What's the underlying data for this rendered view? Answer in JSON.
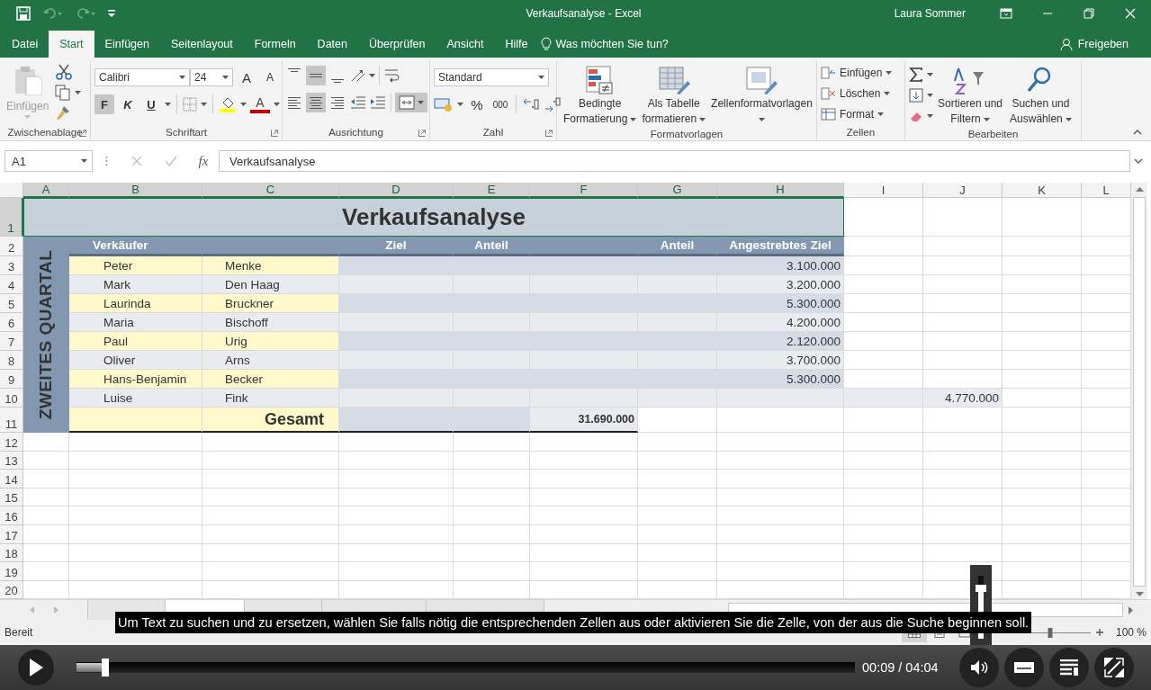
{
  "window": {
    "title": "Verkaufsanalyse - Excel",
    "user": "Laura Sommer"
  },
  "menu": {
    "tabs": [
      {
        "label": "Datei",
        "selected": false
      },
      {
        "label": "Start",
        "selected": true
      },
      {
        "label": "Einfügen",
        "selected": false
      },
      {
        "label": "Seitenlayout",
        "selected": false
      },
      {
        "label": "Formeln",
        "selected": false
      },
      {
        "label": "Daten",
        "selected": false
      },
      {
        "label": "Überprüfen",
        "selected": false
      },
      {
        "label": "Ansicht",
        "selected": false
      },
      {
        "label": "Hilfe",
        "selected": false
      }
    ],
    "tell_me": "Was möchten Sie tun?",
    "share": "Freigeben"
  },
  "ribbon": {
    "clipboard": {
      "label": "Zwischenablage",
      "paste": "Einfügen",
      "paste_disabled": true
    },
    "font": {
      "label": "Schriftart",
      "name": "Calibri",
      "size": "24",
      "grow": "A",
      "shrink": "A",
      "bold": "F",
      "italic": "K",
      "underline": "U",
      "font_color": "A",
      "bold_on": true
    },
    "alignment": {
      "label": "Ausrichtung",
      "vertical": [
        {
          "kind": "top",
          "selected": false
        },
        {
          "kind": "middle",
          "selected": true
        },
        {
          "kind": "bottom",
          "selected": false
        }
      ],
      "horizontal": [
        {
          "kind": "left",
          "selected": false
        },
        {
          "kind": "center",
          "selected": true
        },
        {
          "kind": "right",
          "selected": false
        }
      ],
      "merge_selected": true
    },
    "number": {
      "label": "Zahl",
      "format": "Standard",
      "percent": "%",
      "thousands": "000"
    },
    "styles": {
      "label": "Formatvorlagen",
      "buttons": [
        {
          "kind": "conditional",
          "lines": [
            "Bedingte",
            "Formatierung"
          ]
        },
        {
          "kind": "table",
          "lines": [
            "Als Tabelle",
            "formatieren"
          ]
        },
        {
          "kind": "cellstyles",
          "lines": [
            "Zellenformatvorlagen"
          ]
        }
      ]
    },
    "cells": {
      "label": "Zellen",
      "buttons": [
        {
          "kind": "insert",
          "label": "Einfügen"
        },
        {
          "kind": "delete",
          "label": "Löschen"
        },
        {
          "kind": "format",
          "label": "Format"
        }
      ]
    },
    "editing": {
      "label": "Bearbeiten",
      "buttons": [
        {
          "kind": "sort",
          "lines": [
            "Sortieren und",
            "Filtern"
          ]
        },
        {
          "kind": "find",
          "lines": [
            "Suchen und",
            "Auswählen"
          ]
        }
      ]
    }
  },
  "formula_bar": {
    "name_box": "A1",
    "fx": "fx",
    "formula": "Verkaufsanalyse"
  },
  "sheet": {
    "columns": [
      {
        "label": "A",
        "selected": true
      },
      {
        "label": "B",
        "selected": true
      },
      {
        "label": "C",
        "selected": true
      },
      {
        "label": "D",
        "selected": true
      },
      {
        "label": "E",
        "selected": true
      },
      {
        "label": "F",
        "selected": true
      },
      {
        "label": "G",
        "selected": true
      },
      {
        "label": "H",
        "selected": true
      },
      {
        "label": "I",
        "selected": false
      },
      {
        "label": "J",
        "selected": false
      },
      {
        "label": "K",
        "selected": false
      },
      {
        "label": "L",
        "selected": false
      }
    ],
    "rows": [
      {
        "label": "1",
        "selected": true
      },
      {
        "label": "2",
        "selected": false
      },
      {
        "label": "3",
        "selected": false
      },
      {
        "label": "4",
        "selected": false
      },
      {
        "label": "5",
        "selected": false
      },
      {
        "label": "6",
        "selected": false
      },
      {
        "label": "7",
        "selected": false
      },
      {
        "label": "8",
        "selected": false
      },
      {
        "label": "9",
        "selected": false
      },
      {
        "label": "10",
        "selected": false
      },
      {
        "label": "11",
        "selected": false
      },
      {
        "label": "12",
        "selected": false
      },
      {
        "label": "13",
        "selected": false
      },
      {
        "label": "14",
        "selected": false
      },
      {
        "label": "15",
        "selected": false
      },
      {
        "label": "16",
        "selected": false
      },
      {
        "label": "17",
        "selected": false
      },
      {
        "label": "18",
        "selected": false
      },
      {
        "label": "19",
        "selected": false
      },
      {
        "label": "20",
        "selected": false
      }
    ],
    "title": "Verkaufsanalyse",
    "side_label": "ZWEITES QUARTAL",
    "headers": [
      "Verkäufer",
      "Ziel",
      "Anteil",
      "Anteil",
      "Angestrebtes Ziel"
    ],
    "people": [
      {
        "first": "Peter",
        "last": "Menke",
        "target": "3.100.000"
      },
      {
        "first": "Mark",
        "last": "Den Haag",
        "target": "3.200.000"
      },
      {
        "first": "Laurinda",
        "last": "Bruckner",
        "target": "5.300.000"
      },
      {
        "first": "Maria",
        "last": "Bischoff",
        "target": "4.200.000"
      },
      {
        "first": "Paul",
        "last": "Urig",
        "target": "2.120.000"
      },
      {
        "first": "Oliver",
        "last": "Arns",
        "target": "3.700.000"
      },
      {
        "first": "Hans-Benjamin",
        "last": "Becker",
        "target": "5.300.000"
      },
      {
        "first": "Luise",
        "last": "Fink",
        "side_value": "4.770.000"
      }
    ],
    "total": {
      "label": "Gesamt",
      "value": "31.690.000"
    }
  },
  "sheet_tabs": [
    {
      "selected": false
    },
    {
      "selected": true
    },
    {
      "selected": false
    },
    {
      "selected": false
    },
    {
      "selected": false
    }
  ],
  "status": {
    "text": "Bereit",
    "views": [
      {
        "kind": "normal",
        "selected": true
      },
      {
        "kind": "layout",
        "selected": false
      },
      {
        "kind": "pagebreak",
        "selected": false
      }
    ],
    "zoom_slider": {
      "level": 0.5
    },
    "zoom": "100 %"
  },
  "player": {
    "playing": false,
    "progress": {
      "level": 0.037
    },
    "time": "00:09 / 04:04",
    "volume": {
      "level": 0.8
    },
    "caption": "Um Text zu suchen und zu ersetzen, wählen Sie falls nötig die entsprechenden Zellen aus oder aktivieren Sie die Zelle, von der aus die Suche beginnen soll."
  }
}
